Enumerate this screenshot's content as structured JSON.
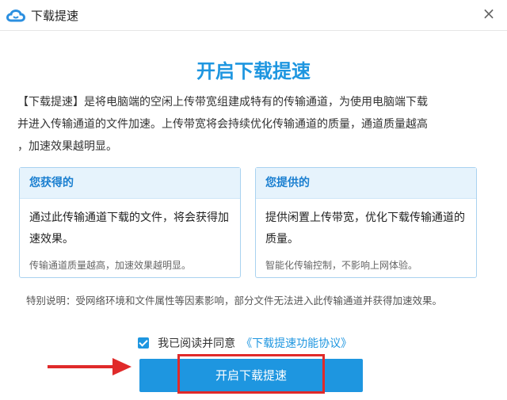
{
  "window": {
    "title": "下载提速",
    "close_symbol": "×",
    "icon": "cloud-logo-icon"
  },
  "main": {
    "heading": "开启下载提速",
    "intro_lines": [
      "【下载提速】是将电脑端的空闲上传带宽组建成特有的传输通道，为使用电脑端下载",
      "并进入传输通道的文件加速。上传带宽将会持续优化传输通道的质量，通道质量越高",
      "，加速效果越明显。"
    ]
  },
  "cards": {
    "get": {
      "title": "您获得的",
      "body": "通过此传输通道下载的文件，将会获得加速效果。",
      "note": "传输通道质量越高，加速效果越明显。"
    },
    "give": {
      "title": "您提供的",
      "body": "提供闲置上传带宽，优化下载传输通道的质量。",
      "note": "智能化传输控制，不影响上网体验。"
    }
  },
  "special_note": "特别说明：受网络环境和文件属性等因素影响，部分文件无法进入此传输通道并获得加速效果。",
  "agreement": {
    "checked": true,
    "text": "我已阅读并同意",
    "link": "《下载提速功能协议》"
  },
  "button": {
    "label": "开启下载提速"
  },
  "colors": {
    "accent": "#1e96e0",
    "annotation_red": "#e02a2a"
  }
}
